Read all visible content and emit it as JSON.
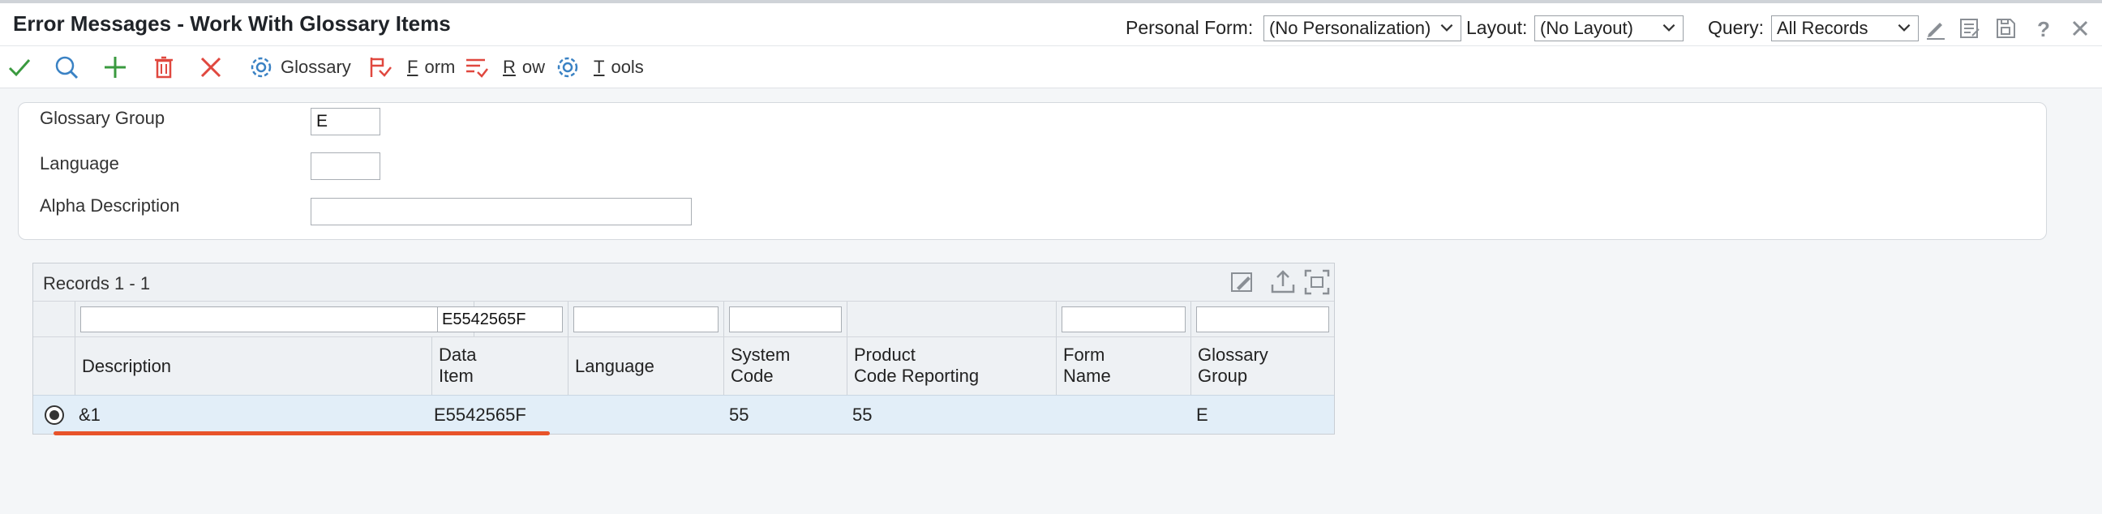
{
  "header": {
    "title": "Error Messages - Work With Glossary Items",
    "personal_form_label": "Personal Form:",
    "personal_form_value": "(No Personalization)",
    "layout_label": "Layout:",
    "layout_value": "(No Layout)",
    "query_label": "Query:",
    "query_value": "All Records"
  },
  "toolbar": {
    "glossary_label": "Glossary",
    "form_first": "F",
    "form_rest": "orm",
    "row_first": "R",
    "row_rest": "ow",
    "tools_first": "T",
    "tools_rest": "ools"
  },
  "criteria": {
    "glossary_group_label": "Glossary Group",
    "glossary_group_value": "E",
    "language_label": "Language",
    "language_value": "",
    "alpha_description_label": "Alpha Description",
    "alpha_description_value": ""
  },
  "grid": {
    "records_label": "Records 1 - 1",
    "filters": {
      "description": "",
      "data_item": "E5542565F",
      "language": "",
      "system_code": "",
      "form_name": "",
      "glossary_group": ""
    },
    "columns": {
      "description": "Description",
      "data_item_1": "Data",
      "data_item_2": "Item",
      "language": "Language",
      "system_code_1": "System",
      "system_code_2": "Code",
      "product_code_1": "Product",
      "product_code_2": "Code Reporting",
      "form_name_1": "Form",
      "form_name_2": "Name",
      "glossary_group_1": "Glossary",
      "glossary_group_2": "Group"
    },
    "rows": [
      {
        "description": "&1",
        "data_item": "E5542565F",
        "language": "",
        "system_code": "55",
        "product_code_reporting": "55",
        "form_name": "",
        "glossary_group": "E"
      }
    ]
  },
  "colors": {
    "accent_green": "#3a9a3f",
    "accent_blue": "#3a82c4",
    "accent_red": "#e0483f",
    "underline_red": "#e8532a",
    "selected_row": "#e2eef8"
  }
}
